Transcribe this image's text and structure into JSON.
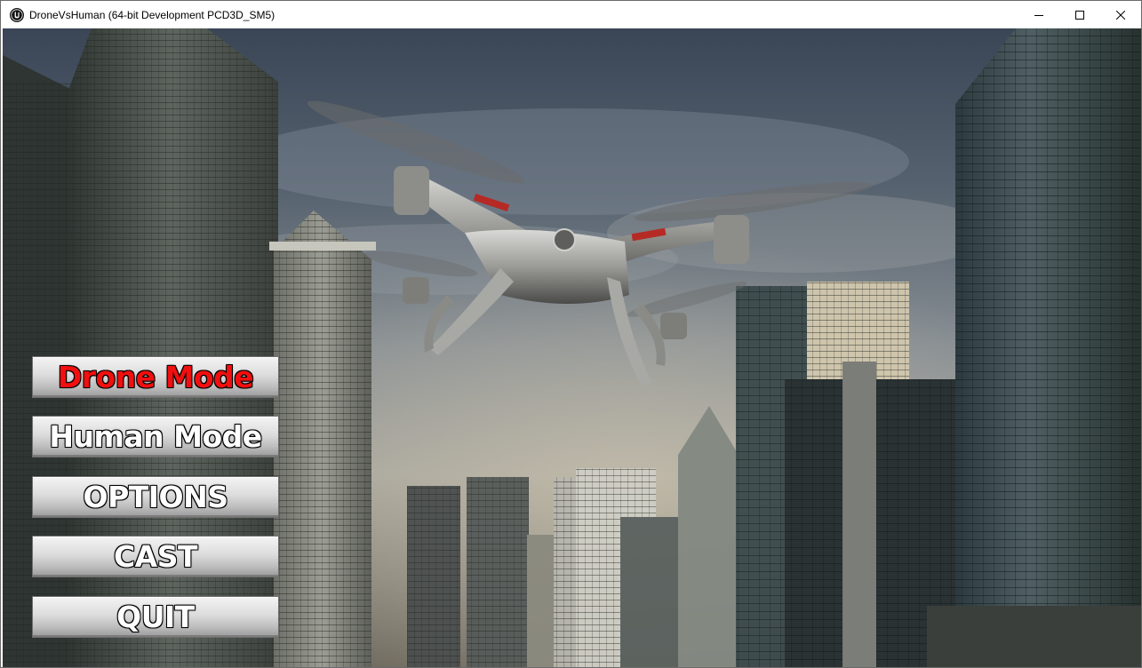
{
  "window": {
    "title": "DroneVsHuman (64-bit Development PCD3D_SM5)",
    "icon": "unreal-engine-icon",
    "controls": [
      "minimize-icon",
      "maximize-icon",
      "close-icon"
    ]
  },
  "menu": {
    "items": [
      {
        "label": "Drone Mode",
        "color": "#f20f0f",
        "active": true
      },
      {
        "label": "Human Mode",
        "color": "#ffffff",
        "active": false
      },
      {
        "label": "OPTIONS",
        "color": "#ffffff",
        "active": false
      },
      {
        "label": "CAST",
        "color": "#ffffff",
        "active": false
      },
      {
        "label": "QUIT",
        "color": "#ffffff",
        "active": false
      }
    ]
  },
  "background": {
    "description_icon": "city-skyline-with-quadcopter-drone"
  }
}
